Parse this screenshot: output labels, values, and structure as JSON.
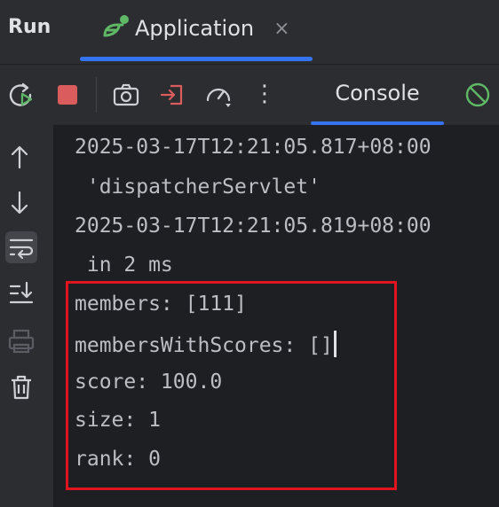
{
  "header": {
    "run_label": "Run",
    "tab_title": "Application",
    "close_glyph": "×"
  },
  "toolbar": {
    "buttons": [
      "rerun-icon",
      "stop-icon",
      "screenshot-icon",
      "exit-icon",
      "profiler-icon",
      "more-icon"
    ],
    "more_glyph": "⋮",
    "console_tab": "Console",
    "clear_icon": "no-entry-icon"
  },
  "sidebar": {
    "icons": [
      "arrow-up-icon",
      "arrow-down-icon",
      "soft-wrap-icon",
      "scroll-to-end-icon",
      "print-icon",
      "trash-icon"
    ]
  },
  "console": {
    "lines": [
      "2025-03-17T12:21:05.817+08:00",
      " 'dispatcherServlet'",
      "2025-03-17T12:21:05.819+08:00",
      " in 2 ms",
      "members: [111]",
      "membersWithScores: []",
      "score: 100.0",
      "size: 1",
      "rank: 0"
    ]
  },
  "colors": {
    "accent": "#3574f0",
    "highlight": "#e0141e",
    "stop": "#db5c5c",
    "run_green": "#5fb865"
  }
}
